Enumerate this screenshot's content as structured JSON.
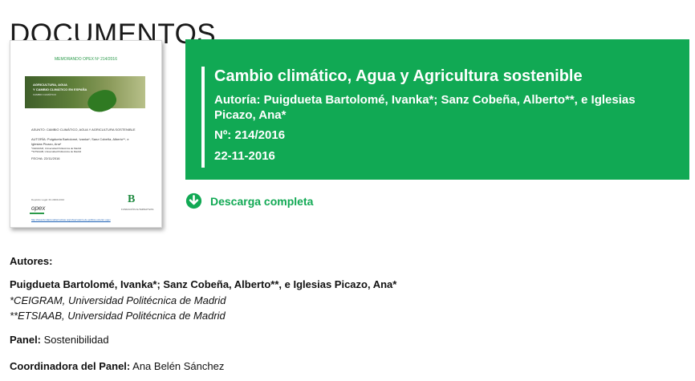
{
  "page": {
    "heading": "DOCUMENTOS"
  },
  "thumbnail": {
    "memo_line": "MEMORANDO OPEX Nº 214/2016",
    "banner_line1": "AGRICULTURA, AGUA",
    "banner_line2": "Y CAMBIO CLIMÁTICO EN ESPAÑA",
    "banner_line3": "CAMBIO CLIMÁTICO",
    "subject": "ASUNTO: CAMBIO CLIMÁTICO, AGUA Y AGRICULTURA SOSTENIBLE",
    "authors_line1": "AUTORÍA: Puigdueta Bartolomé, Ivanka*; Sanz Cobeña, Alberto**, e",
    "authors_line2": "Iglesias Picazo, Ana*",
    "affil1": "*CEIGRAM, Universidad Politécnica de Madrid",
    "affil2": "**ETSIAAB, Universidad Politécnica de Madrid",
    "date_line": "FECHA: 22/11/2016",
    "footer_text": "Depósito Legal: M-14999-2010",
    "opex_logo": "opex",
    "brand_letter": "B",
    "brand_text": "FUNDACIÓN ALTERNATIVAS",
    "url": "http://www.fundacionalternativas.org/observatorio-de-politica-exterior-opex"
  },
  "card": {
    "title": "Cambio climático, Agua y Agricultura sostenible",
    "authors": "Autoría: Puigdueta Bartolomé, Ivanka*; Sanz Cobeña, Alberto**, e Iglesias Picazo, Ana*",
    "number": "Nº: 214/2016",
    "date": "22-11-2016",
    "background_color": "#11a954"
  },
  "download": {
    "label": "Descarga completa",
    "icon": "download-circle-icon",
    "color": "#11a954"
  },
  "details": {
    "authors_label": "Autores:",
    "authors_value": "Puigdueta Bartolomé, Ivanka*; Sanz Cobeña, Alberto**, e Iglesias Picazo, Ana*",
    "affiliation1": "*CEIGRAM, Universidad Politécnica de Madrid",
    "affiliation2": "**ETSIAAB, Universidad Politécnica de Madrid",
    "panel_label": "Panel:",
    "panel_value": "Sostenibilidad",
    "coordinator_label": "Coordinadora del Panel:",
    "coordinator_value": "Ana Belén Sánchez"
  }
}
